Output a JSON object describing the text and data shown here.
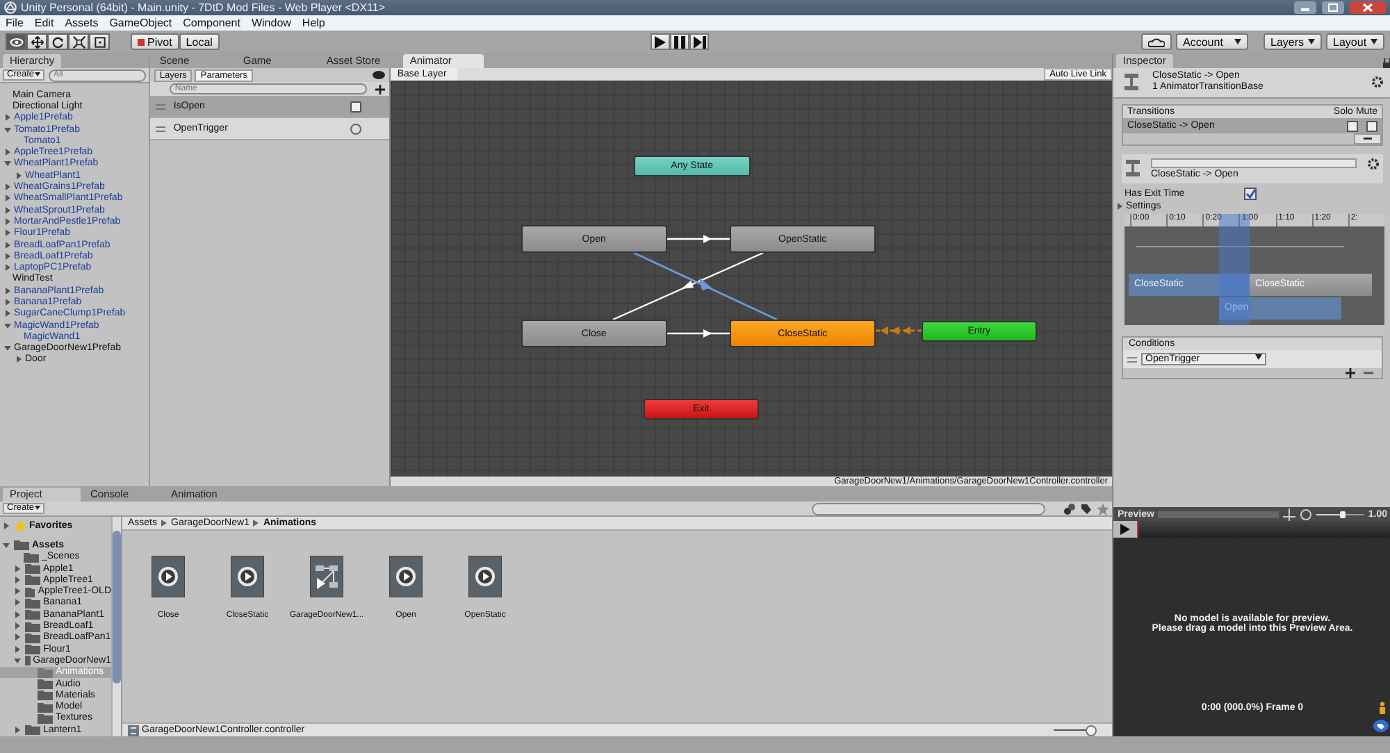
{
  "window": {
    "title": "Unity Personal (64bit) - Main.unity - 7DtD Mod Files - Web Player <DX11>"
  },
  "menu": [
    "File",
    "Edit",
    "Assets",
    "GameObject",
    "Component",
    "Window",
    "Help"
  ],
  "toolbar": {
    "tools": [
      {
        "kind": "view",
        "selected": true
      },
      {
        "kind": "move",
        "selected": false
      },
      {
        "kind": "rotate",
        "selected": false
      },
      {
        "kind": "scale",
        "selected": false
      },
      {
        "kind": "rect",
        "selected": false
      }
    ],
    "pivot": "Pivot",
    "local": "Local",
    "account": "Account",
    "layers": "Layers",
    "layout": "Layout"
  },
  "hierarchy": {
    "title": "Hierarchy",
    "create": "Create",
    "placeholder": "All",
    "items": [
      {
        "label": "Main Camera",
        "prefab": false
      },
      {
        "label": "Directional Light",
        "prefab": false
      },
      {
        "label": "Apple1Prefab",
        "prefab": true,
        "expanded": false
      },
      {
        "label": "Tomato1Prefab",
        "prefab": true,
        "expanded": true,
        "children": [
          {
            "label": "Tomato1",
            "prefab": true
          }
        ]
      },
      {
        "label": "AppleTree1Prefab",
        "prefab": true,
        "expanded": false
      },
      {
        "label": "WheatPlant1Prefab",
        "prefab": true,
        "expanded": true,
        "children": [
          {
            "label": "WheatPlant1",
            "prefab": true,
            "expanded": false
          }
        ]
      },
      {
        "label": "WheatGrains1Prefab",
        "prefab": true,
        "expanded": false
      },
      {
        "label": "WheatSmallPlant1Prefab",
        "prefab": true,
        "expanded": false
      },
      {
        "label": "WheatSprout1Prefab",
        "prefab": true,
        "expanded": false
      },
      {
        "label": "MortarAndPestle1Prefab",
        "prefab": true,
        "expanded": false
      },
      {
        "label": "Flour1Prefab",
        "prefab": true,
        "expanded": false
      },
      {
        "label": "BreadLoafPan1Prefab",
        "prefab": true,
        "expanded": false
      },
      {
        "label": "BreadLoaf1Prefab",
        "prefab": true,
        "expanded": false
      },
      {
        "label": "LaptopPC1Prefab",
        "prefab": true,
        "expanded": false
      },
      {
        "label": "WindTest",
        "prefab": false
      },
      {
        "label": "BananaPlant1Prefab",
        "prefab": true,
        "expanded": false
      },
      {
        "label": "Banana1Prefab",
        "prefab": true,
        "expanded": false
      },
      {
        "label": "SugarCaneClump1Prefab",
        "prefab": true,
        "expanded": false
      },
      {
        "label": "MagicWand1Prefab",
        "prefab": true,
        "expanded": true,
        "children": [
          {
            "label": "MagicWand1",
            "prefab": true
          }
        ]
      },
      {
        "label": "GarageDoorNew1Prefab",
        "prefab": false,
        "expanded": true,
        "children": [
          {
            "label": "Door",
            "prefab": false,
            "expanded": false
          }
        ]
      }
    ]
  },
  "center_tabs": [
    {
      "label": "Scene",
      "selected": false
    },
    {
      "label": "Game",
      "selected": false
    },
    {
      "label": "Asset Store",
      "selected": false
    },
    {
      "label": "Animator",
      "selected": true
    }
  ],
  "animator": {
    "side_tabs": [
      {
        "label": "Layers",
        "selected": false
      },
      {
        "label": "Parameters",
        "selected": true
      }
    ],
    "placeholder": "Name",
    "parameters": [
      {
        "name": "IsOpen",
        "kind": "bool",
        "checked": false,
        "selected": true
      },
      {
        "name": "OpenTrigger",
        "kind": "trigger",
        "checked": false,
        "selected": false
      }
    ],
    "breadcrumb": "Base Layer",
    "live_link": "Auto Live Link",
    "states": [
      {
        "name": "Any State",
        "kind": "any"
      },
      {
        "name": "Open",
        "kind": "state"
      },
      {
        "name": "OpenStatic",
        "kind": "state"
      },
      {
        "name": "Close",
        "kind": "state"
      },
      {
        "name": "CloseStatic",
        "kind": "default"
      },
      {
        "name": "Entry",
        "kind": "entry"
      },
      {
        "name": "Exit",
        "kind": "exit"
      }
    ],
    "path": "GarageDoorNew1/Animations/GarageDoorNew1Controller.controller"
  },
  "inspector": {
    "title": "Inspector",
    "heading": "CloseStatic -> Open",
    "subheading": "1 AnimatorTransitionBase",
    "transitions_label": "Transitions",
    "solo_label": "Solo",
    "mute_label": "Mute",
    "transitions": [
      {
        "name": "CloseStatic -> Open",
        "solo": false,
        "mute": false,
        "selected": true
      }
    ],
    "transition_name": "CloseStatic -> Open",
    "has_exit_time_label": "Has Exit Time",
    "has_exit_time": true,
    "settings_label": "Settings",
    "settings_expanded": false,
    "ticks": [
      "0:00",
      "0:10",
      "0:20",
      "1:00",
      "1:10",
      "1:20",
      "2:"
    ],
    "clips": [
      "CloseStatic",
      "CloseStatic",
      "Open"
    ],
    "conditions_label": "Conditions",
    "conditions": [
      "OpenTrigger"
    ]
  },
  "bottom_tabs": [
    {
      "label": "Project",
      "selected": true
    },
    {
      "label": "Console",
      "selected": false
    },
    {
      "label": "Animation",
      "selected": false
    }
  ],
  "project": {
    "create": "Create",
    "favorites": "Favorites",
    "root": "Assets",
    "folders": [
      {
        "label": "_Scenes",
        "selected": false
      },
      {
        "label": "Apple1",
        "expanded": false,
        "selected": false
      },
      {
        "label": "AppleTree1",
        "expanded": false,
        "selected": false
      },
      {
        "label": "AppleTree1-OLD",
        "expanded": false,
        "selected": false
      },
      {
        "label": "Banana1",
        "expanded": false,
        "selected": false
      },
      {
        "label": "BananaPlant1",
        "expanded": false,
        "selected": false
      },
      {
        "label": "BreadLoaf1",
        "expanded": false,
        "selected": false
      },
      {
        "label": "BreadLoafPan1",
        "expanded": false,
        "selected": false
      },
      {
        "label": "Flour1",
        "expanded": false,
        "selected": false
      },
      {
        "label": "GarageDoorNew1",
        "expanded": true,
        "selected": false,
        "children": [
          {
            "label": "Animations",
            "selected": true
          },
          {
            "label": "Audio",
            "selected": false
          },
          {
            "label": "Materials",
            "selected": false
          },
          {
            "label": "Model",
            "selected": false
          },
          {
            "label": "Textures",
            "selected": false
          }
        ]
      },
      {
        "label": "Lantern1",
        "expanded": false,
        "selected": false
      }
    ],
    "breadcrumb": [
      "Assets",
      "GarageDoorNew1",
      "Animations"
    ],
    "assets": [
      {
        "name": "Close",
        "kind": "clip"
      },
      {
        "name": "CloseStatic",
        "kind": "clip"
      },
      {
        "name": "GarageDoorNew1...",
        "kind": "controller"
      },
      {
        "name": "Open",
        "kind": "clip"
      },
      {
        "name": "OpenStatic",
        "kind": "clip"
      }
    ],
    "selected_file": "GarageDoorNew1Controller.controller",
    "zoom": {
      "level": 0.92
    }
  },
  "preview": {
    "title": "Preview",
    "speed": "1.00",
    "speed_slider": {
      "level": 0.55
    },
    "message": [
      "No model is available for preview.",
      "Please drag a model into this Preview Area."
    ],
    "frame": "0:00 (000.0%) Frame 0"
  }
}
